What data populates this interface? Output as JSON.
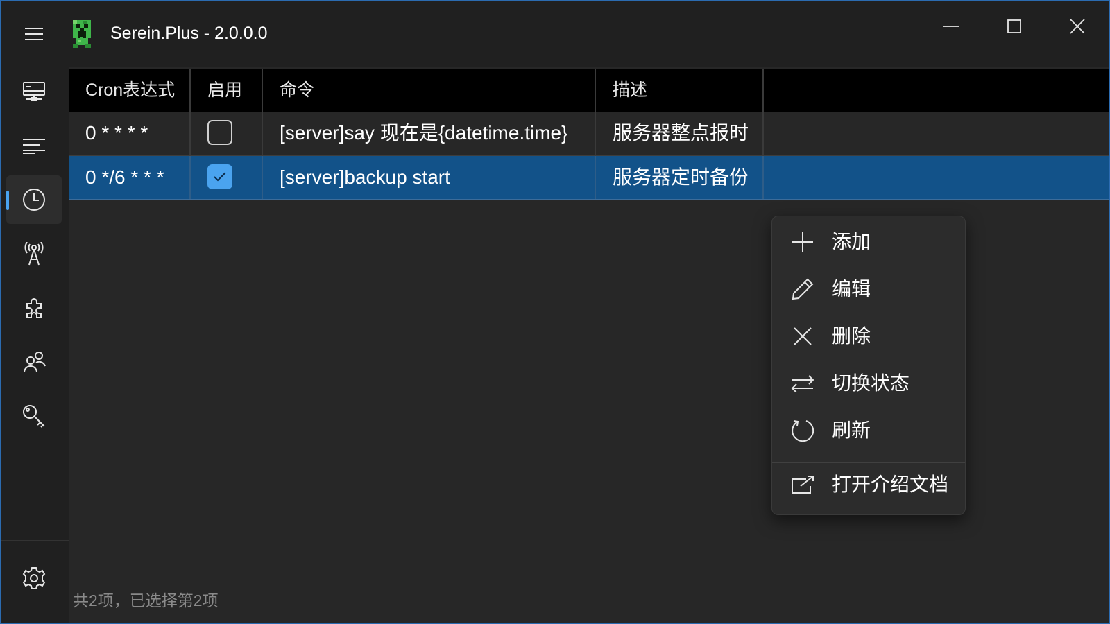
{
  "app": {
    "title": "Serein.Plus - 2.0.0.0"
  },
  "window_controls": {
    "minimize": "minimize",
    "maximize": "maximize",
    "close": "close"
  },
  "sidebar": {
    "items": [
      {
        "name": "server",
        "icon": "server-icon",
        "active": false
      },
      {
        "name": "console",
        "icon": "lines-icon",
        "active": false
      },
      {
        "name": "schedule",
        "icon": "clock-icon",
        "active": true
      },
      {
        "name": "connection",
        "icon": "antenna-icon",
        "active": false
      },
      {
        "name": "plugins",
        "icon": "puzzle-icon",
        "active": false
      },
      {
        "name": "members",
        "icon": "users-icon",
        "active": false
      },
      {
        "name": "permissions",
        "icon": "key-icon",
        "active": false
      }
    ],
    "settings_icon": "gear-icon"
  },
  "table": {
    "columns": [
      "Cron表达式",
      "启用",
      "命令",
      "描述"
    ],
    "rows": [
      {
        "cron": "0 * * * *",
        "enabled": false,
        "command": "[server]say 现在是{datetime.time}",
        "description": "服务器整点报时",
        "selected": false
      },
      {
        "cron": "0 */6 * * *",
        "enabled": true,
        "command": "[server]backup start",
        "description": "服务器定时备份",
        "selected": true
      }
    ]
  },
  "status": {
    "text": "共2项，已选择第2项"
  },
  "context_menu": {
    "items": [
      {
        "label": "添加",
        "icon": "plus-icon"
      },
      {
        "label": "编辑",
        "icon": "pencil-icon"
      },
      {
        "label": "删除",
        "icon": "close-icon"
      },
      {
        "label": "切换状态",
        "icon": "swap-icon"
      },
      {
        "label": "刷新",
        "icon": "refresh-icon"
      },
      {
        "label": "打开介绍文档",
        "icon": "open-external-icon"
      }
    ]
  },
  "colors": {
    "accent": "#4aa3ef",
    "selected_row": "#125289",
    "background": "#202020",
    "content_background": "#272727"
  }
}
